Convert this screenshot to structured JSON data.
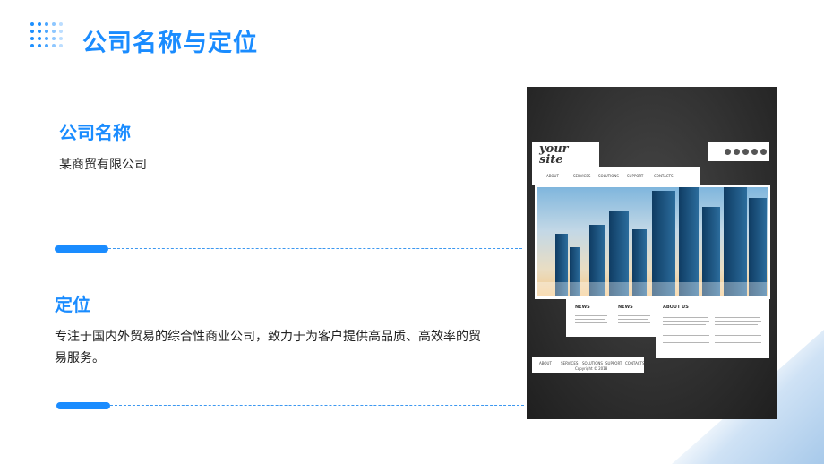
{
  "header": {
    "title": "公司名称与定位"
  },
  "company_name": {
    "heading": "公司名称",
    "value": "某商贸有限公司"
  },
  "positioning": {
    "heading": "定位",
    "text_line1": "专注于国内外贸易的综合性商业公司，致力于为客户提供高品质、高效率的贸",
    "text_line2": "易服务。"
  },
  "mockup": {
    "logo_line1": "your",
    "logo_line2": "site",
    "nav": [
      "ABOUT",
      "SERVICES",
      "SOLUTIONS",
      "SUPPORT",
      "CONTACTS"
    ],
    "news_1": "NEWS",
    "news_2": "NEWS",
    "about": "ABOUT US",
    "footer_nav": [
      "ABOUT",
      "SERVICES",
      "SOLUTIONS",
      "SUPPORT",
      "CONTACTS"
    ],
    "copyright": "Copyright © 2018"
  },
  "colors": {
    "accent": "#1a8cff",
    "dark_panel": "#2b2b2b"
  }
}
